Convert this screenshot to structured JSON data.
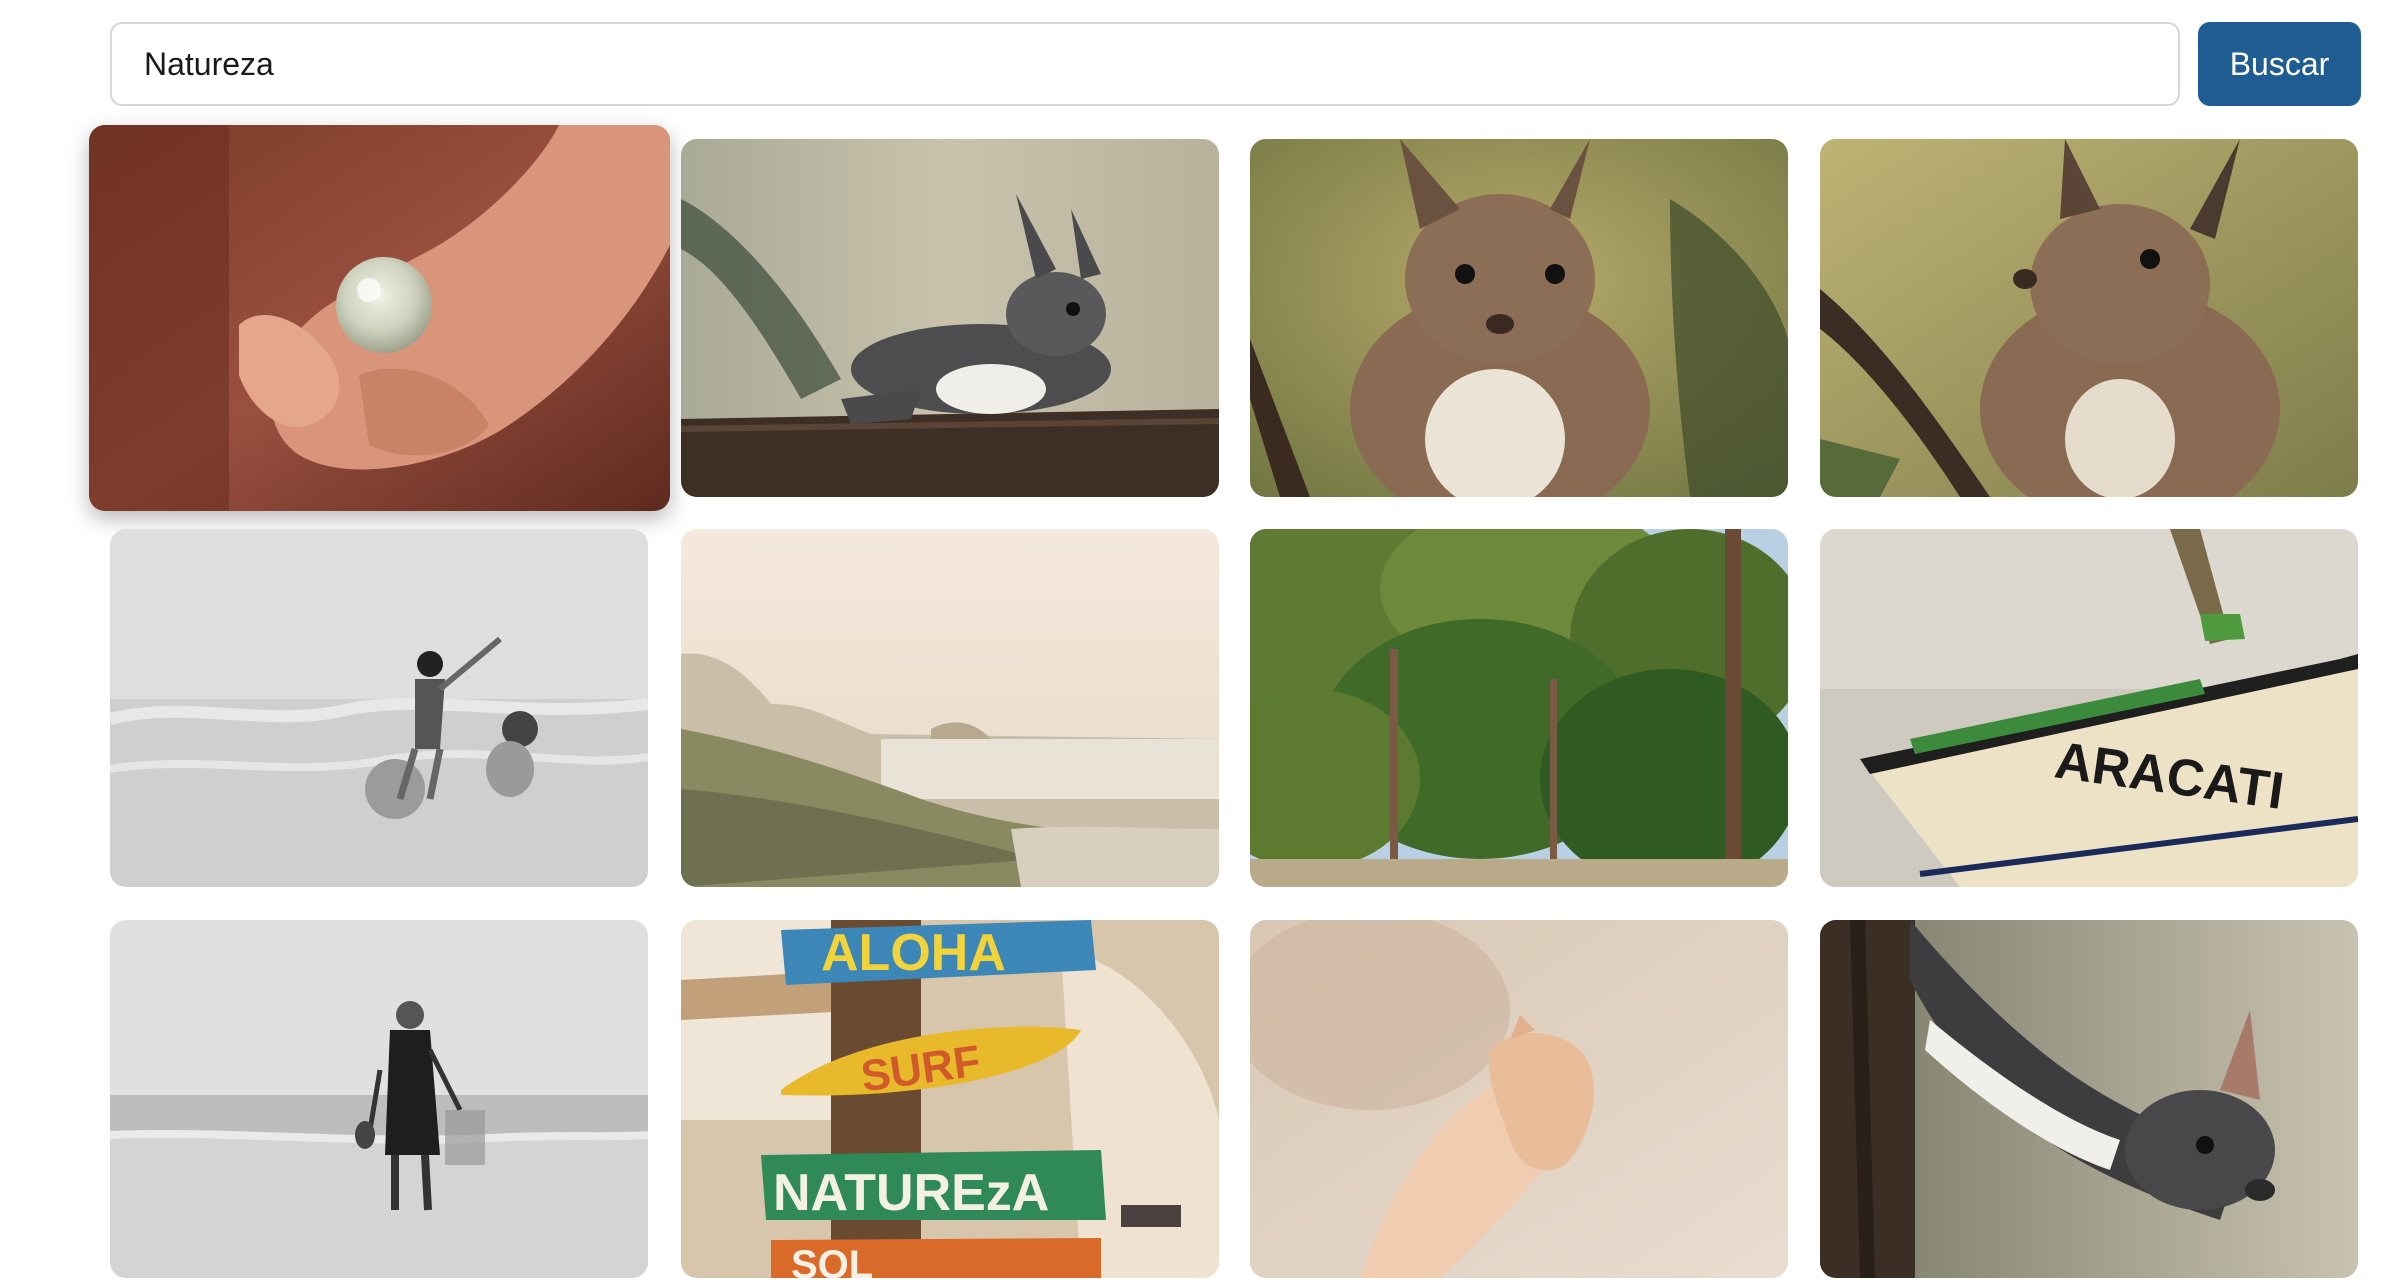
{
  "search": {
    "value": "Natureza",
    "button_label": "Buscar"
  },
  "gallery": {
    "signs": {
      "aloha": "ALOHA",
      "surf": "SURF",
      "natureza": "NATUREzA",
      "sol": "SOL"
    },
    "boat_name": "ARACATI"
  }
}
